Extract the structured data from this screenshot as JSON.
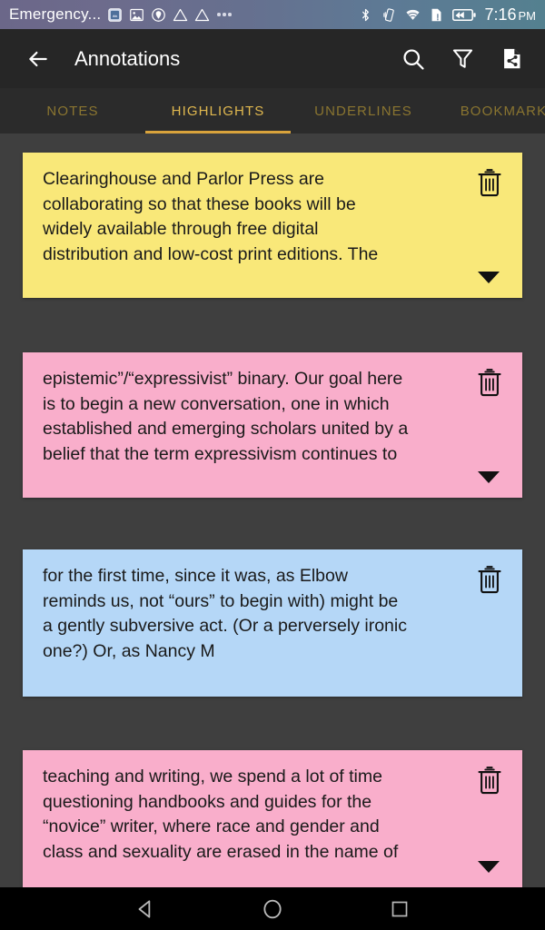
{
  "status_bar": {
    "carrier": "Emergency...",
    "time": "7:16",
    "meridiem": "PM",
    "left_icons": [
      "app-notification-icon",
      "photo-icon",
      "shield-location-icon",
      "warning-triangle-icon",
      "warning-triangle-icon",
      "overflow-dots-icon"
    ],
    "right_icons": [
      "bluetooth-icon",
      "vibrate-icon",
      "wifi-icon",
      "sim-alert-icon",
      "battery-charging-icon"
    ],
    "background_gradient_start": "#6b6789",
    "background_gradient_end": "#54808f"
  },
  "toolbar": {
    "back_icon": "back-arrow-icon",
    "title": "Annotations",
    "actions": [
      {
        "name": "search-button",
        "icon": "search-icon"
      },
      {
        "name": "filter-button",
        "icon": "filter-funnel-icon"
      },
      {
        "name": "share-document-button",
        "icon": "share-document-icon"
      }
    ],
    "background": "#262626"
  },
  "tabs": {
    "active_index": 1,
    "active_color": "#e0b84f",
    "inactive_color": "#8a7530",
    "indicator_color": "#d9a33c",
    "items": [
      {
        "label": "NOTES"
      },
      {
        "label": "HIGHLIGHTS"
      },
      {
        "label": "UNDERLINES"
      },
      {
        "label": "BOOKMARKS"
      }
    ]
  },
  "list": {
    "background": "#3f3f3f",
    "cards": [
      {
        "text": "Clearinghouse and Parlor Press are\ncollaborating so that these books will be\nwidely available through free digital\ndistribution and low-cost print editions. The",
        "color": "#f9e879",
        "has_expand_chevron": true,
        "delete_icon": "trash-icon"
      },
      {
        "text": "epistemic”/“expressivist” binary. Our goal here\nis to begin a new conversation, one in which\nestablished and emerging scholars united by a\nbelief that the term expressivism continues to",
        "color": "#f9aecb",
        "has_expand_chevron": true,
        "delete_icon": "trash-icon"
      },
      {
        "text": "for the first time, since it was, as Elbow\nreminds us, not “ours” to begin with) might be\na gently subversive act. (Or a perversely ironic\none?) Or, as Nancy M",
        "color": "#b5d7f7",
        "has_expand_chevron": false,
        "delete_icon": "trash-icon"
      },
      {
        "text": "teaching and writing, we spend a lot of time\nquestioning handbooks and guides for the\n“novice” writer, where race and gender and\nclass and sexuality are erased in the name of",
        "color": "#f9aecb",
        "has_expand_chevron": true,
        "delete_icon": "trash-icon"
      }
    ]
  },
  "navbar": {
    "background": "#000000",
    "buttons": [
      {
        "name": "nav-back-button",
        "icon": "triangle-back-icon"
      },
      {
        "name": "nav-home-button",
        "icon": "circle-home-icon"
      },
      {
        "name": "nav-recents-button",
        "icon": "square-recents-icon"
      }
    ]
  }
}
